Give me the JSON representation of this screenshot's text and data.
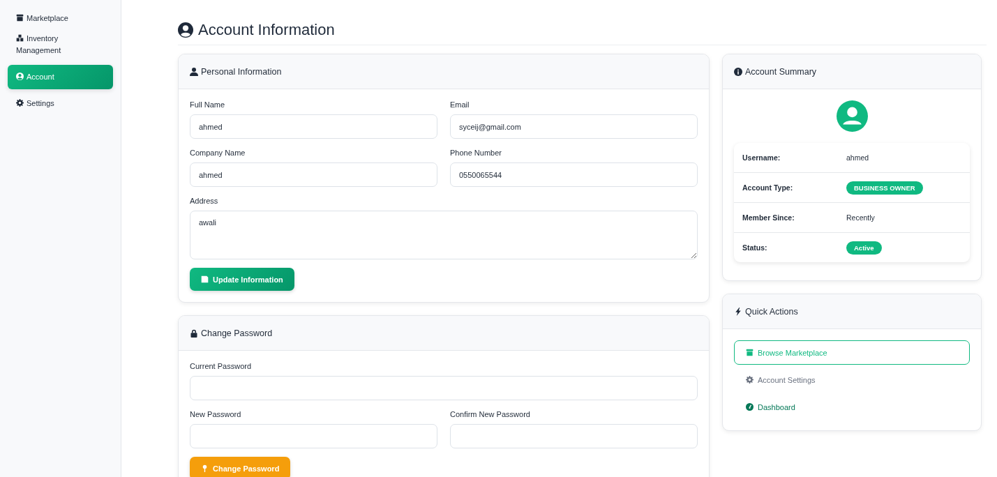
{
  "sidebar": {
    "items": [
      {
        "label": "Marketplace",
        "selected": false
      },
      {
        "label": "Inventory Management",
        "selected": false
      },
      {
        "label": "Account",
        "selected": true
      },
      {
        "label": "Settings",
        "selected": false
      }
    ]
  },
  "page_title": "Account Information",
  "personal_information": {
    "title": "Personal Information",
    "fields": [
      {
        "label": "Full Name",
        "value": "ahmed",
        "kind": "input",
        "wide": false
      },
      {
        "label": "Email",
        "value": "syceij@gmail.com",
        "kind": "input",
        "wide": false
      },
      {
        "label": "Company Name",
        "value": "ahmed",
        "kind": "input",
        "wide": false
      },
      {
        "label": "Phone Number",
        "value": "0550065544",
        "kind": "input",
        "wide": false
      },
      {
        "label": "Address",
        "value": "awali",
        "kind": "textarea",
        "wide": true
      }
    ],
    "button": "Update Information"
  },
  "change_password": {
    "title": "Change Password",
    "fields": [
      {
        "label": "Current Password",
        "kind": "input",
        "wide": true
      },
      {
        "label": "New Password",
        "kind": "input",
        "wide": false
      },
      {
        "label": "Confirm New Password",
        "kind": "input",
        "wide": false
      }
    ],
    "button": "Change Password"
  },
  "account_summary": {
    "title": "Account Summary",
    "rows": [
      {
        "label": "Username:",
        "value": "ahmed",
        "kind": "text"
      },
      {
        "label": "Account Type:",
        "value": "BUSINESS OWNER",
        "kind": "badge"
      },
      {
        "label": "Member Since:",
        "value": "Recently",
        "kind": "text"
      },
      {
        "label": "Status:",
        "value": "Active",
        "kind": "badge"
      }
    ]
  },
  "quick_actions": {
    "title": "Quick Actions",
    "items": [
      {
        "label": "Browse Marketplace",
        "kind": "primary"
      },
      {
        "label": "Account Settings",
        "kind": "secondary"
      },
      {
        "label": "Dashboard",
        "kind": "success"
      }
    ]
  }
}
